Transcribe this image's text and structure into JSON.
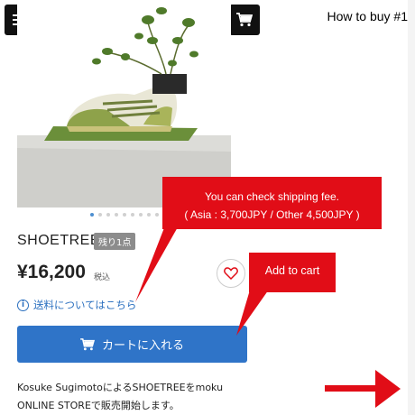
{
  "header": {
    "menu_icon": "hamburger-menu-icon",
    "rss_icon": "rss-follow-icon",
    "cart_icon": "cart-icon",
    "tutorial_label": "How to buy #1"
  },
  "product": {
    "image_alt": "sneaker planter",
    "name": "SHOETREE",
    "stock_badge": "残り1点",
    "price": "¥16,200",
    "tax_label": "税込",
    "shipping_link": "送料についてはこちら",
    "add_to_cart": "カートに入れる",
    "description_line1": "Kosuke SugimotoによるSHOETREEをmoku",
    "description_line2": "ONLINE STOREで販売開始します。"
  },
  "carousel": {
    "total_images": 10,
    "active_index": 0
  },
  "callouts": {
    "shipping_line1": "You can check shipping fee.",
    "shipping_line2": "( Asia : 3,700JPY / Other 4,500JPY )",
    "cart": "Add to cart"
  },
  "colors": {
    "accent_red": "#e10d17",
    "cart_button_blue": "#2f74c8",
    "link_blue": "#2a6fbf"
  }
}
